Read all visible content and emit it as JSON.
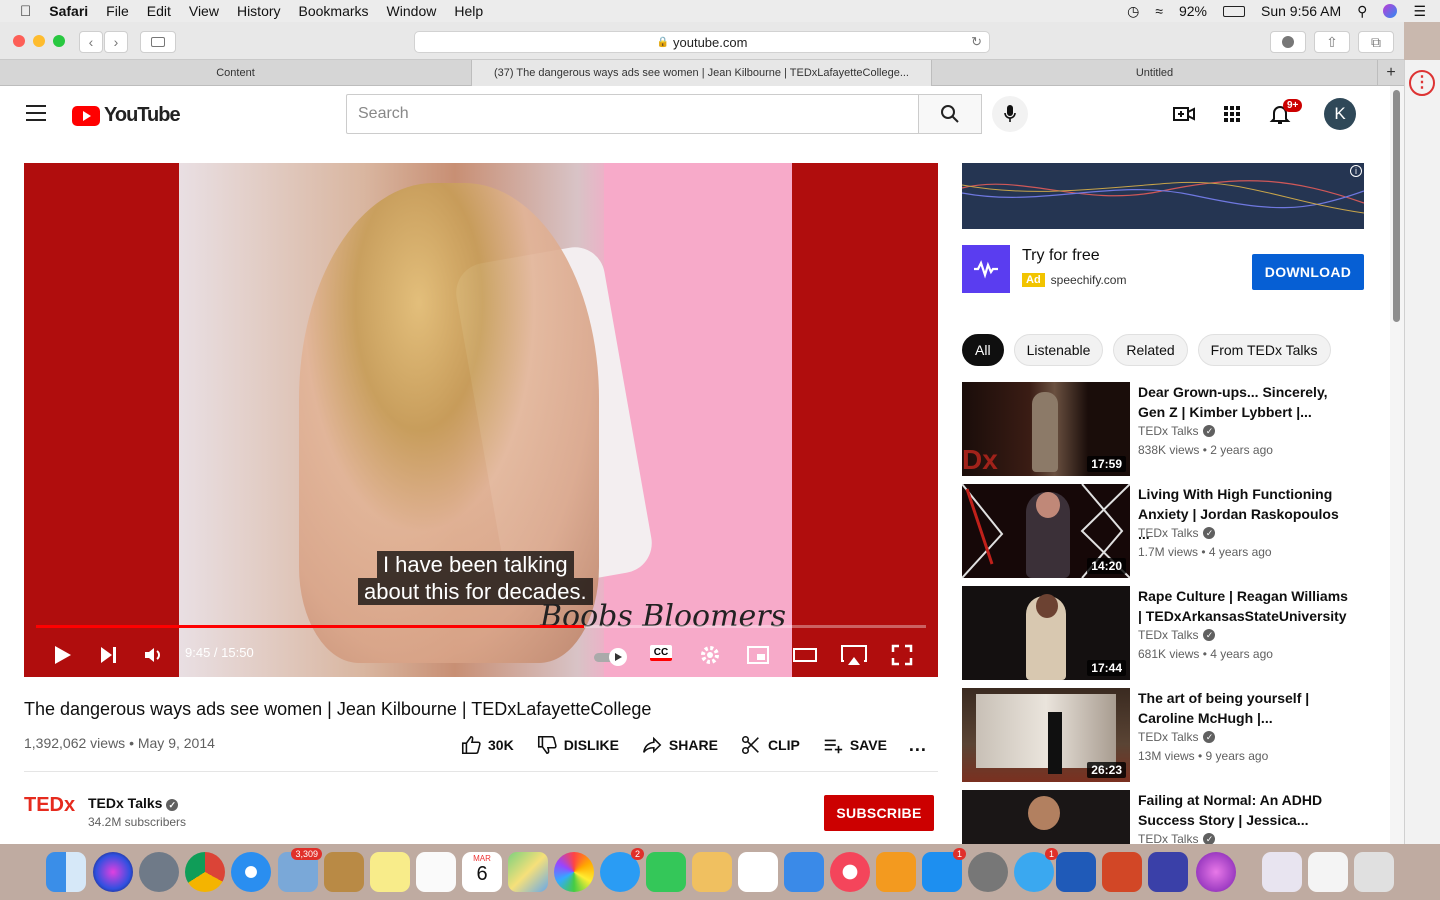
{
  "menubar": {
    "apple": "",
    "app": "Safari",
    "items": [
      "File",
      "Edit",
      "View",
      "History",
      "Bookmarks",
      "Window",
      "Help"
    ],
    "battery": "92%",
    "clock": "Sun 9:56 AM"
  },
  "browser": {
    "url": "youtube.com",
    "tabs": [
      {
        "title": "Content"
      },
      {
        "title": "(37) The dangerous ways ads see women | Jean Kilbourne | TEDxLafayetteCollege..."
      },
      {
        "title": "Untitled"
      }
    ]
  },
  "youtube": {
    "logo_text": "YouTube",
    "search_placeholder": "Search",
    "notifications_badge": "9+",
    "avatar_letter": "K"
  },
  "player": {
    "caption_line1": "I have been talking",
    "caption_line2": "about this for decades.",
    "brand_text": "Boobs Bloomers",
    "time": "9:45 / 15:50",
    "progress": 0.616
  },
  "video": {
    "title": "The dangerous ways ads see women | Jean Kilbourne | TEDxLafayetteCollege",
    "meta": "1,392,062 views • May 9, 2014",
    "likes": "30K",
    "dislike": "DISLIKE",
    "share": "SHARE",
    "clip": "CLIP",
    "save": "SAVE",
    "more": "..."
  },
  "channel": {
    "logo": "TEDx",
    "name": "TEDx Talks",
    "subscribers": "34.2M subscribers",
    "subscribe_label": "SUBSCRIBE"
  },
  "ad": {
    "title": "Try for free",
    "tag": "Ad",
    "url": "speechify.com",
    "cta": "DOWNLOAD"
  },
  "chips": [
    "All",
    "Listenable",
    "Related",
    "From TEDx Talks"
  ],
  "recommendations": [
    {
      "title": "Dear Grown-ups... Sincerely, Gen Z | Kimber Lybbert |...",
      "channel": "TEDx Talks",
      "meta": "838K views • 2 years ago",
      "duration": "17:59"
    },
    {
      "title": "Living With High Functioning Anxiety | Jordan Raskopoulos ...",
      "channel": "TEDx Talks",
      "meta": "1.7M views • 4 years ago",
      "duration": "14:20"
    },
    {
      "title": "Rape Culture | Reagan Williams | TEDxArkansasStateUniversity",
      "channel": "TEDx Talks",
      "meta": "681K views • 4 years ago",
      "duration": "17:44"
    },
    {
      "title": "The art of being yourself | Caroline McHugh |...",
      "channel": "TEDx Talks",
      "meta": "13M views • 9 years ago",
      "duration": "26:23"
    },
    {
      "title": "Failing at Normal: An ADHD Success Story | Jessica...",
      "channel": "TEDx Talks",
      "meta": "",
      "duration": ""
    }
  ],
  "dock": {
    "mail_badge": "3,309",
    "messages_badge": "2",
    "appstore_badge": "1",
    "other_badge": "1",
    "calendar_month": "MAR",
    "calendar_day": "6"
  }
}
